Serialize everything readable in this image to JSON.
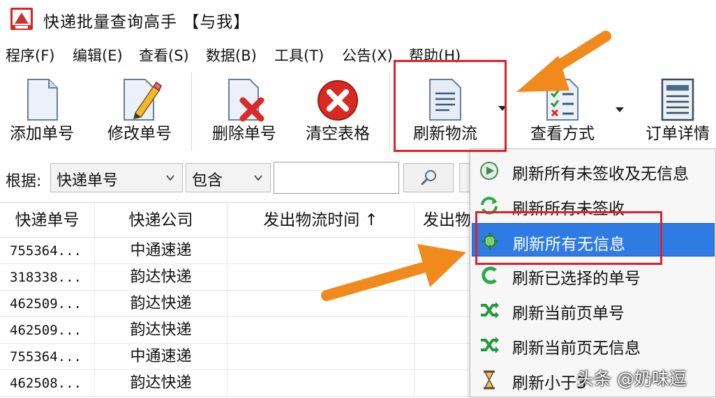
{
  "window": {
    "title": "快递批量查询高手 【与我】"
  },
  "menu": [
    "程序(F)",
    "编辑(E)",
    "查看(S)",
    "数据(B)",
    "工具(T)",
    "公告(X)",
    "帮助(H)"
  ],
  "toolbar": {
    "add": "添加单号",
    "edit": "修改单号",
    "delete": "删除单号",
    "clear": "清空表格",
    "refresh": "刷新物流",
    "view_mode": "查看方式",
    "order_detail": "订单详情"
  },
  "filter": {
    "by_label": "根据:",
    "field_value": "快递单号",
    "match_value": "包含",
    "query_value": ""
  },
  "table": {
    "headers": [
      "快递单号",
      "快递公司",
      "发出物流时间 ↑",
      "发出物"
    ],
    "rows": [
      [
        "755364...",
        "中通速递"
      ],
      [
        "318338...",
        "韵达快递"
      ],
      [
        "462509...",
        "韵达快递"
      ],
      [
        "462509...",
        "韵达快递"
      ],
      [
        "755364...",
        "中通速递"
      ],
      [
        "462508...",
        "韵达快递"
      ]
    ]
  },
  "refresh_menu": {
    "items": [
      {
        "label": "刷新所有未签收及无信息",
        "icon": "refresh-play-icon"
      },
      {
        "label": "刷新所有未签收",
        "icon": "refresh-arrows-icon"
      },
      {
        "label": "刷新所有无信息",
        "icon": "refresh-gear-icon"
      },
      {
        "label": "刷新已选择的单号",
        "icon": "refresh-left-icon"
      },
      {
        "label": "刷新当前页单号",
        "icon": "shuffle-icon"
      },
      {
        "label": "刷新当前页无信息",
        "icon": "shuffle-icon"
      },
      {
        "label": "刷新小于3",
        "icon": "hourglass-icon"
      }
    ],
    "highlighted_index": 2
  },
  "watermark": "头条 @奶味逗",
  "colors": {
    "highlight": "#2f7be4",
    "annotation_box": "#e0202a",
    "annotation_arrow": "#f08a1c"
  }
}
